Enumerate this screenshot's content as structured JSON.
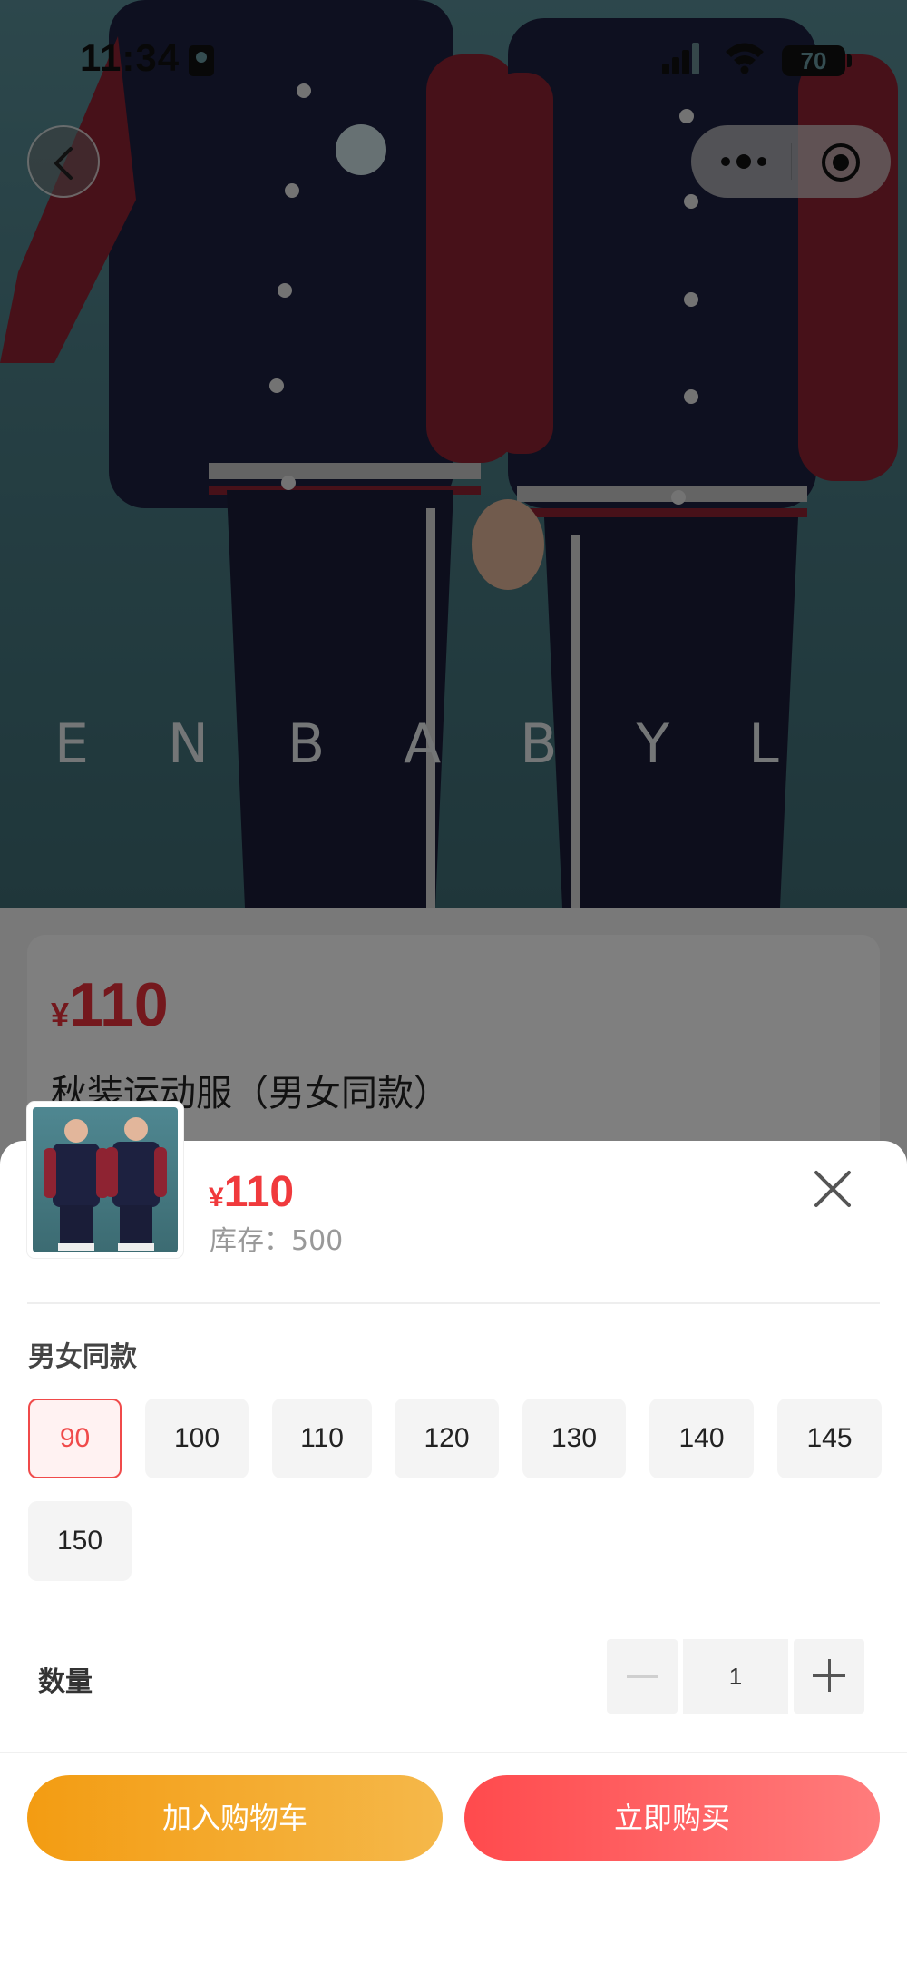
{
  "status_bar": {
    "time": "11:34",
    "battery": "70"
  },
  "product": {
    "currency": "¥",
    "price": "110",
    "name": "秋装运动服（男女同款）",
    "hero_watermark": "E N   B A B Y   L"
  },
  "sheet": {
    "currency": "¥",
    "price": "110",
    "stock_text": "库存：500",
    "spec_group_title": "男女同款",
    "options": [
      "90",
      "100",
      "110",
      "120",
      "130",
      "140",
      "145",
      "150"
    ],
    "selected_option": "90",
    "quantity_label": "数量",
    "quantity_value": "1",
    "add_to_cart_label": "加入购物车",
    "buy_now_label": "立即购买"
  },
  "icons": {
    "back": "chevron-left-icon",
    "more": "more-dots-icon",
    "target": "target-icon",
    "close": "close-icon",
    "minus": "minus-icon",
    "plus": "plus-icon"
  },
  "colors": {
    "price_red": "#f03a3d",
    "cart_orange": "#f39c12",
    "buy_red": "#ff4a4d",
    "selected_border": "#f04a4a"
  }
}
